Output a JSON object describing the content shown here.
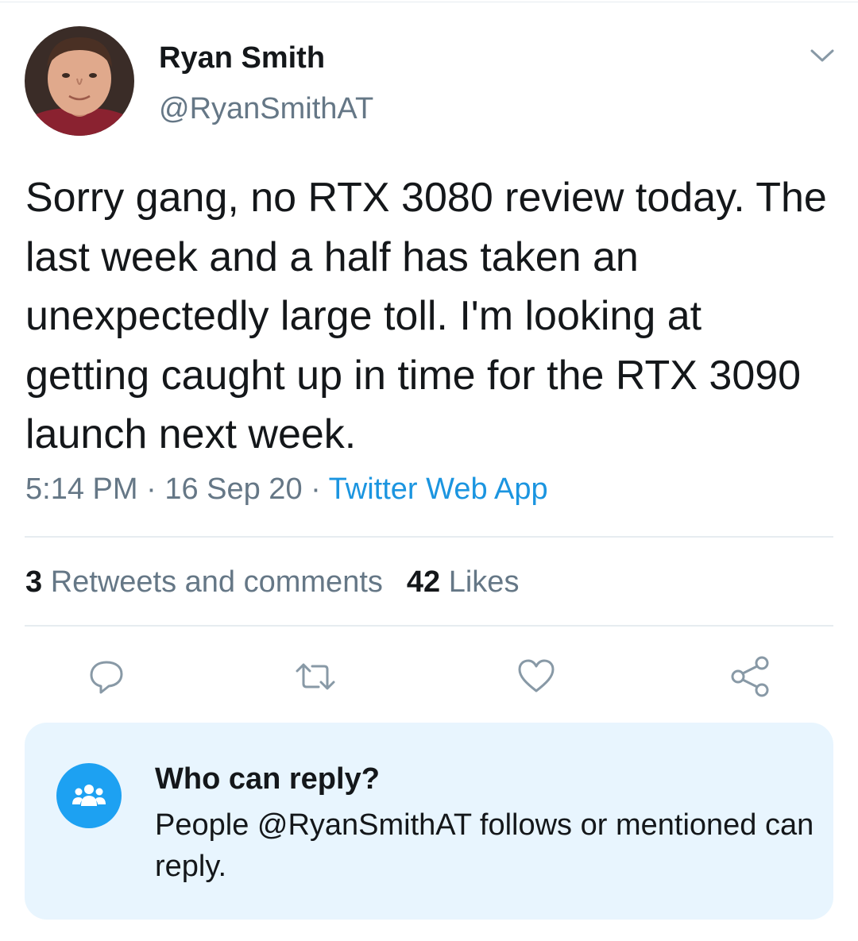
{
  "tweet": {
    "author": {
      "display_name": "Ryan Smith",
      "handle": "@RyanSmithAT",
      "avatar_icon": "profile-photo"
    },
    "menu_icon": "chevron-down-icon",
    "text": "Sorry gang, no RTX 3080 review today. The last week and a half has taken an unexpectedly large toll. I'm looking at getting caught up in time for the RTX 3090 launch next week.",
    "time": "5:14 PM",
    "separator": " · ",
    "date": "16 Sep 20",
    "source": "Twitter Web App"
  },
  "stats": {
    "retweets_count": "3",
    "retweets_label": " Retweets and comments",
    "likes_count": "42",
    "likes_label": " Likes"
  },
  "actions": [
    {
      "name": "reply",
      "icon": "comment-icon"
    },
    {
      "name": "retweet",
      "icon": "retweet-icon"
    },
    {
      "name": "like",
      "icon": "heart-icon"
    },
    {
      "name": "share",
      "icon": "share-icon"
    }
  ],
  "reply_settings": {
    "icon": "people-icon",
    "title": "Who can reply?",
    "description": "People @RyanSmithAT follows or mentioned can reply."
  },
  "colors": {
    "text_primary": "#14171a",
    "text_secondary": "#657786",
    "link": "#1b95e0",
    "accent": "#1da1f2",
    "icon_gray": "#8899a6",
    "divider": "#e6ecf0",
    "reply_box_bg": "#e8f5fe"
  }
}
